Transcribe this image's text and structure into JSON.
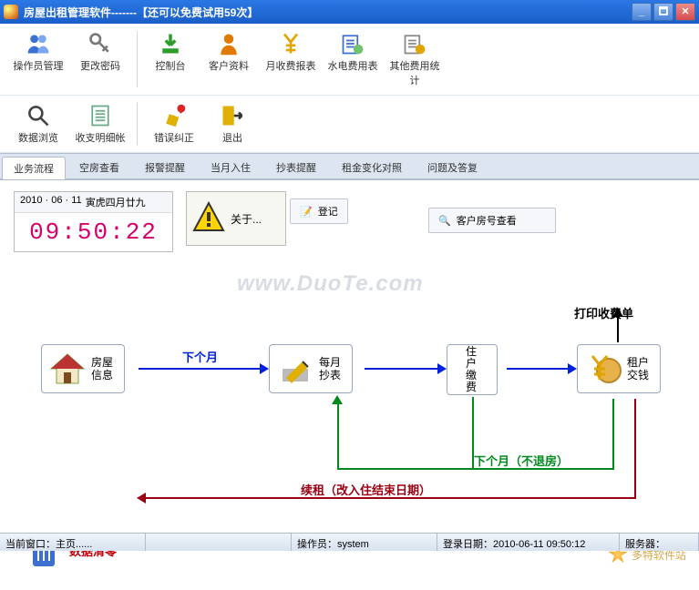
{
  "title": "房屋出租管理软件-------【还可以免费试用59次】",
  "winbtns": {
    "min": "_",
    "max": "🗖",
    "close": "✕"
  },
  "toolbar1": [
    {
      "label": "操作员管理",
      "icon": "users-icon"
    },
    {
      "label": "更改密码",
      "icon": "keys-icon"
    },
    {
      "sep": true
    },
    {
      "label": "控制台",
      "icon": "download-icon"
    },
    {
      "label": "客户资料",
      "icon": "person-icon"
    },
    {
      "label": "月收费报表",
      "icon": "yen-report-icon"
    },
    {
      "label": "水电费用表",
      "icon": "util-report-icon"
    },
    {
      "label": "其他费用统计",
      "icon": "other-fee-icon"
    }
  ],
  "toolbar2": [
    {
      "label": "数据浏览",
      "icon": "magnify-icon"
    },
    {
      "label": "收支明细帐",
      "icon": "ledger-icon"
    },
    {
      "sep": true
    },
    {
      "label": "错误纠正",
      "icon": "pencil-error-icon"
    },
    {
      "label": "退出",
      "icon": "exit-icon"
    }
  ],
  "tabs": [
    {
      "label": "业务流程",
      "active": true
    },
    {
      "label": "空房查看"
    },
    {
      "label": "报警提醒"
    },
    {
      "label": "当月入住"
    },
    {
      "label": "抄表提醒"
    },
    {
      "label": "租金变化对照"
    },
    {
      "label": "问题及答复"
    }
  ],
  "datebox": {
    "date": "2010 · 06 · 11",
    "lunar": "寅虎四月廿九",
    "time": "09:50:22"
  },
  "about": "关于...",
  "chip": {
    "reg": "登记",
    "lookup": "客户房号查看"
  },
  "watermark": "www.DuoTe.com",
  "flow": {
    "house": "房屋\n信息",
    "meter": "每月\n抄表",
    "pay": "住户缴费",
    "coin": "租户\n交钱",
    "print": "打印收费单",
    "next": "下个月",
    "next2": "下个月（不退房）",
    "renew": "续租（改入住结束日期）",
    "clear": "数据清零"
  },
  "watermark2": "多特软件站",
  "status": {
    "winlabel": "当前窗口：",
    "winval": "主页......",
    "oplabel": "操作员：",
    "opval": "system",
    "dtlabel": "登录日期：",
    "dtval": "2010-06-11 09:50:12",
    "srv": "服务器："
  }
}
